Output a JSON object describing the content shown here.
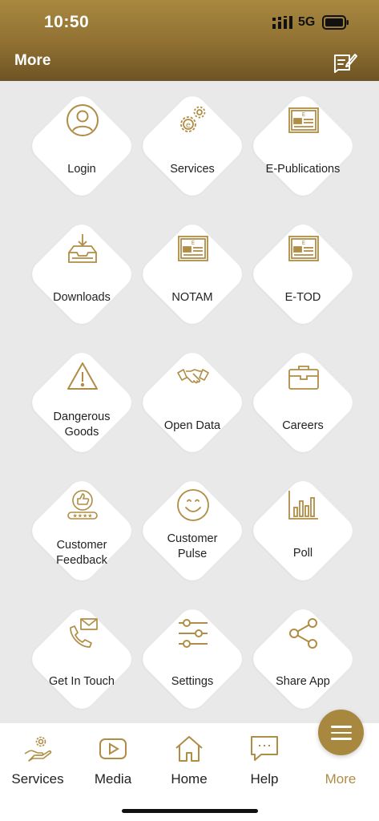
{
  "status": {
    "time": "10:50",
    "network": "5G"
  },
  "header": {
    "title": "More",
    "action_icon": "edit-note-icon"
  },
  "colors": {
    "accent": "#b08d44",
    "header_top": "#a8883f",
    "header_bottom": "#6e5323",
    "background": "#e9e9e9"
  },
  "tiles": [
    {
      "label": "Login",
      "icon": "user-icon"
    },
    {
      "label": "Services",
      "icon": "gears-icon"
    },
    {
      "label": "E-Publications",
      "icon": "newspaper-icon"
    },
    {
      "label": "Downloads",
      "icon": "download-tray-icon"
    },
    {
      "label": "NOTAM",
      "icon": "newspaper-icon"
    },
    {
      "label": "E-TOD",
      "icon": "newspaper-icon"
    },
    {
      "label": "Dangerous\nGoods",
      "icon": "warning-icon"
    },
    {
      "label": "Open Data",
      "icon": "handshake-icon"
    },
    {
      "label": "Careers",
      "icon": "briefcase-icon"
    },
    {
      "label": "Customer\nFeedback",
      "icon": "thumbs-up-rating-icon"
    },
    {
      "label": "Customer\nPulse",
      "icon": "smiley-icon"
    },
    {
      "label": "Poll",
      "icon": "bar-chart-icon"
    },
    {
      "label": "Get In Touch",
      "icon": "phone-mail-icon"
    },
    {
      "label": "Settings",
      "icon": "sliders-icon"
    },
    {
      "label": "Share App",
      "icon": "share-icon"
    }
  ],
  "nav": [
    {
      "label": "Services",
      "icon": "hand-gear-icon"
    },
    {
      "label": "Media",
      "icon": "play-icon"
    },
    {
      "label": "Home",
      "icon": "home-icon"
    },
    {
      "label": "Help",
      "icon": "chat-icon"
    },
    {
      "label": "More",
      "icon": "menu-icon"
    }
  ]
}
